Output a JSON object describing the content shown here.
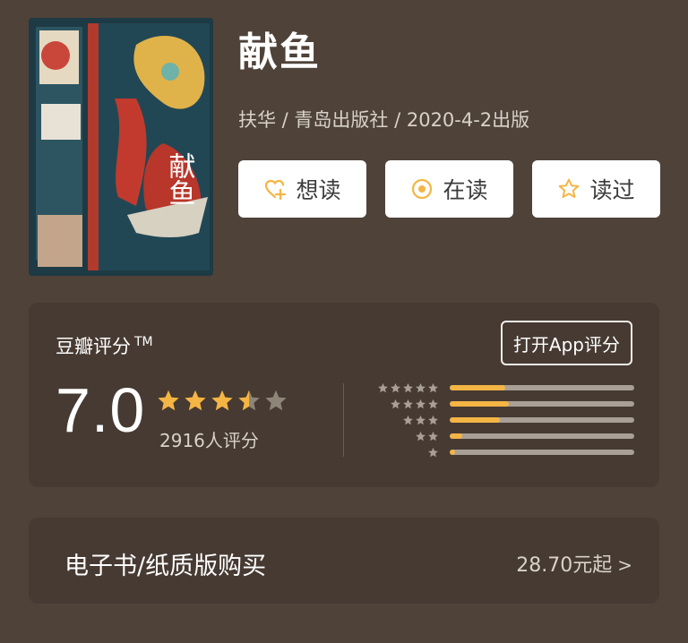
{
  "book": {
    "title": "献鱼",
    "meta": "扶华 / 青岛出版社 / 2020-4-2出版",
    "cover_text": "献鱼"
  },
  "actions": [
    {
      "label": "想读",
      "icon": "heart-plus-icon"
    },
    {
      "label": "在读",
      "icon": "reading-circle-icon"
    },
    {
      "label": "读过",
      "icon": "star-outline-icon"
    }
  ],
  "rating": {
    "label": "豆瓣评分",
    "tm": "TM",
    "open_app": "打开App评分",
    "score": "7.0",
    "stars": 3.5,
    "count": "2916人评分",
    "distribution": [
      {
        "stars": 5,
        "fraction": 0.3
      },
      {
        "stars": 4,
        "fraction": 0.32
      },
      {
        "stars": 3,
        "fraction": 0.27
      },
      {
        "stars": 2,
        "fraction": 0.07
      },
      {
        "stars": 1,
        "fraction": 0.03
      }
    ]
  },
  "purchase": {
    "label": "电子书/纸质版购买",
    "price": "28.70元起",
    "chevron": ">"
  },
  "colors": {
    "background": "#4f4239",
    "panel": "#463a32",
    "star": "#f5b544",
    "star_empty": "#8e8478",
    "bar_track": "#a99f96"
  }
}
